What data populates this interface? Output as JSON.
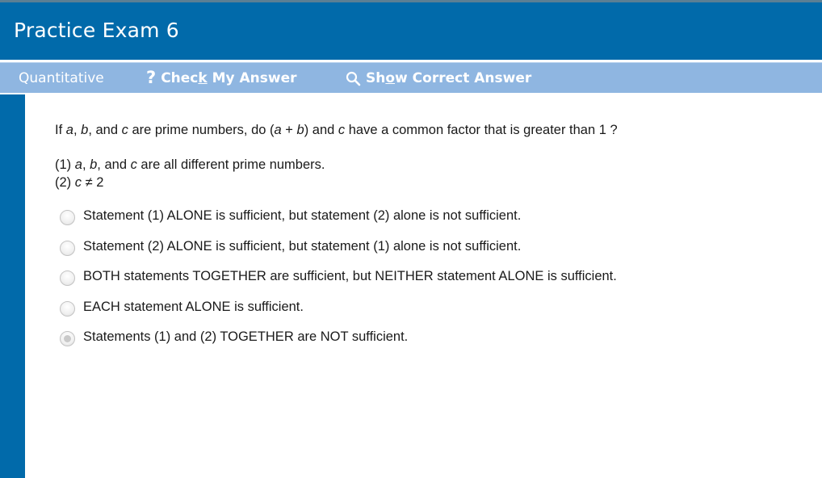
{
  "header": {
    "title": "Practice Exam 6"
  },
  "toolbar": {
    "section": "Quantitative",
    "check_pre": "Chec",
    "check_u": "k",
    "check_post": " My Answer",
    "show_pre": "Sh",
    "show_u": "o",
    "show_post": "w Correct Answer"
  },
  "question": {
    "p1": "If ",
    "a": "a",
    "p2": ", ",
    "b": "b",
    "p3": ", and ",
    "c": "c",
    "p4": " are prime numbers, do (",
    "a2": "a",
    "p5": " + ",
    "b2": "b",
    "p6": ") and ",
    "c2": "c",
    "p7": " have a common factor that is greater than 1 ?"
  },
  "statements": {
    "s1_pre": "(1) ",
    "s1_a": "a",
    "s1_sep1": ", ",
    "s1_b": "b",
    "s1_sep2": ", and ",
    "s1_c": "c",
    "s1_post": " are all different prime numbers.",
    "s2_pre": "(2) ",
    "s2_c": "c",
    "s2_post": " ≠ 2"
  },
  "options": [
    {
      "label": "Statement (1) ALONE is sufficient, but statement (2) alone is not sufficient.",
      "selected": false
    },
    {
      "label": "Statement (2) ALONE is sufficient, but statement (1) alone is not sufficient.",
      "selected": false
    },
    {
      "label": "BOTH statements TOGETHER are sufficient, but NEITHER statement ALONE is sufficient.",
      "selected": false
    },
    {
      "label": "EACH statement ALONE is sufficient.",
      "selected": false
    },
    {
      "label": "Statements (1) and (2) TOGETHER are NOT sufficient.",
      "selected": true
    }
  ],
  "icons": {
    "help": "question-mark-icon",
    "show": "magnifier-icon"
  },
  "colors": {
    "header": "#016aaa",
    "toolbar": "#8fb6e1",
    "text": "#1a1a1a"
  }
}
